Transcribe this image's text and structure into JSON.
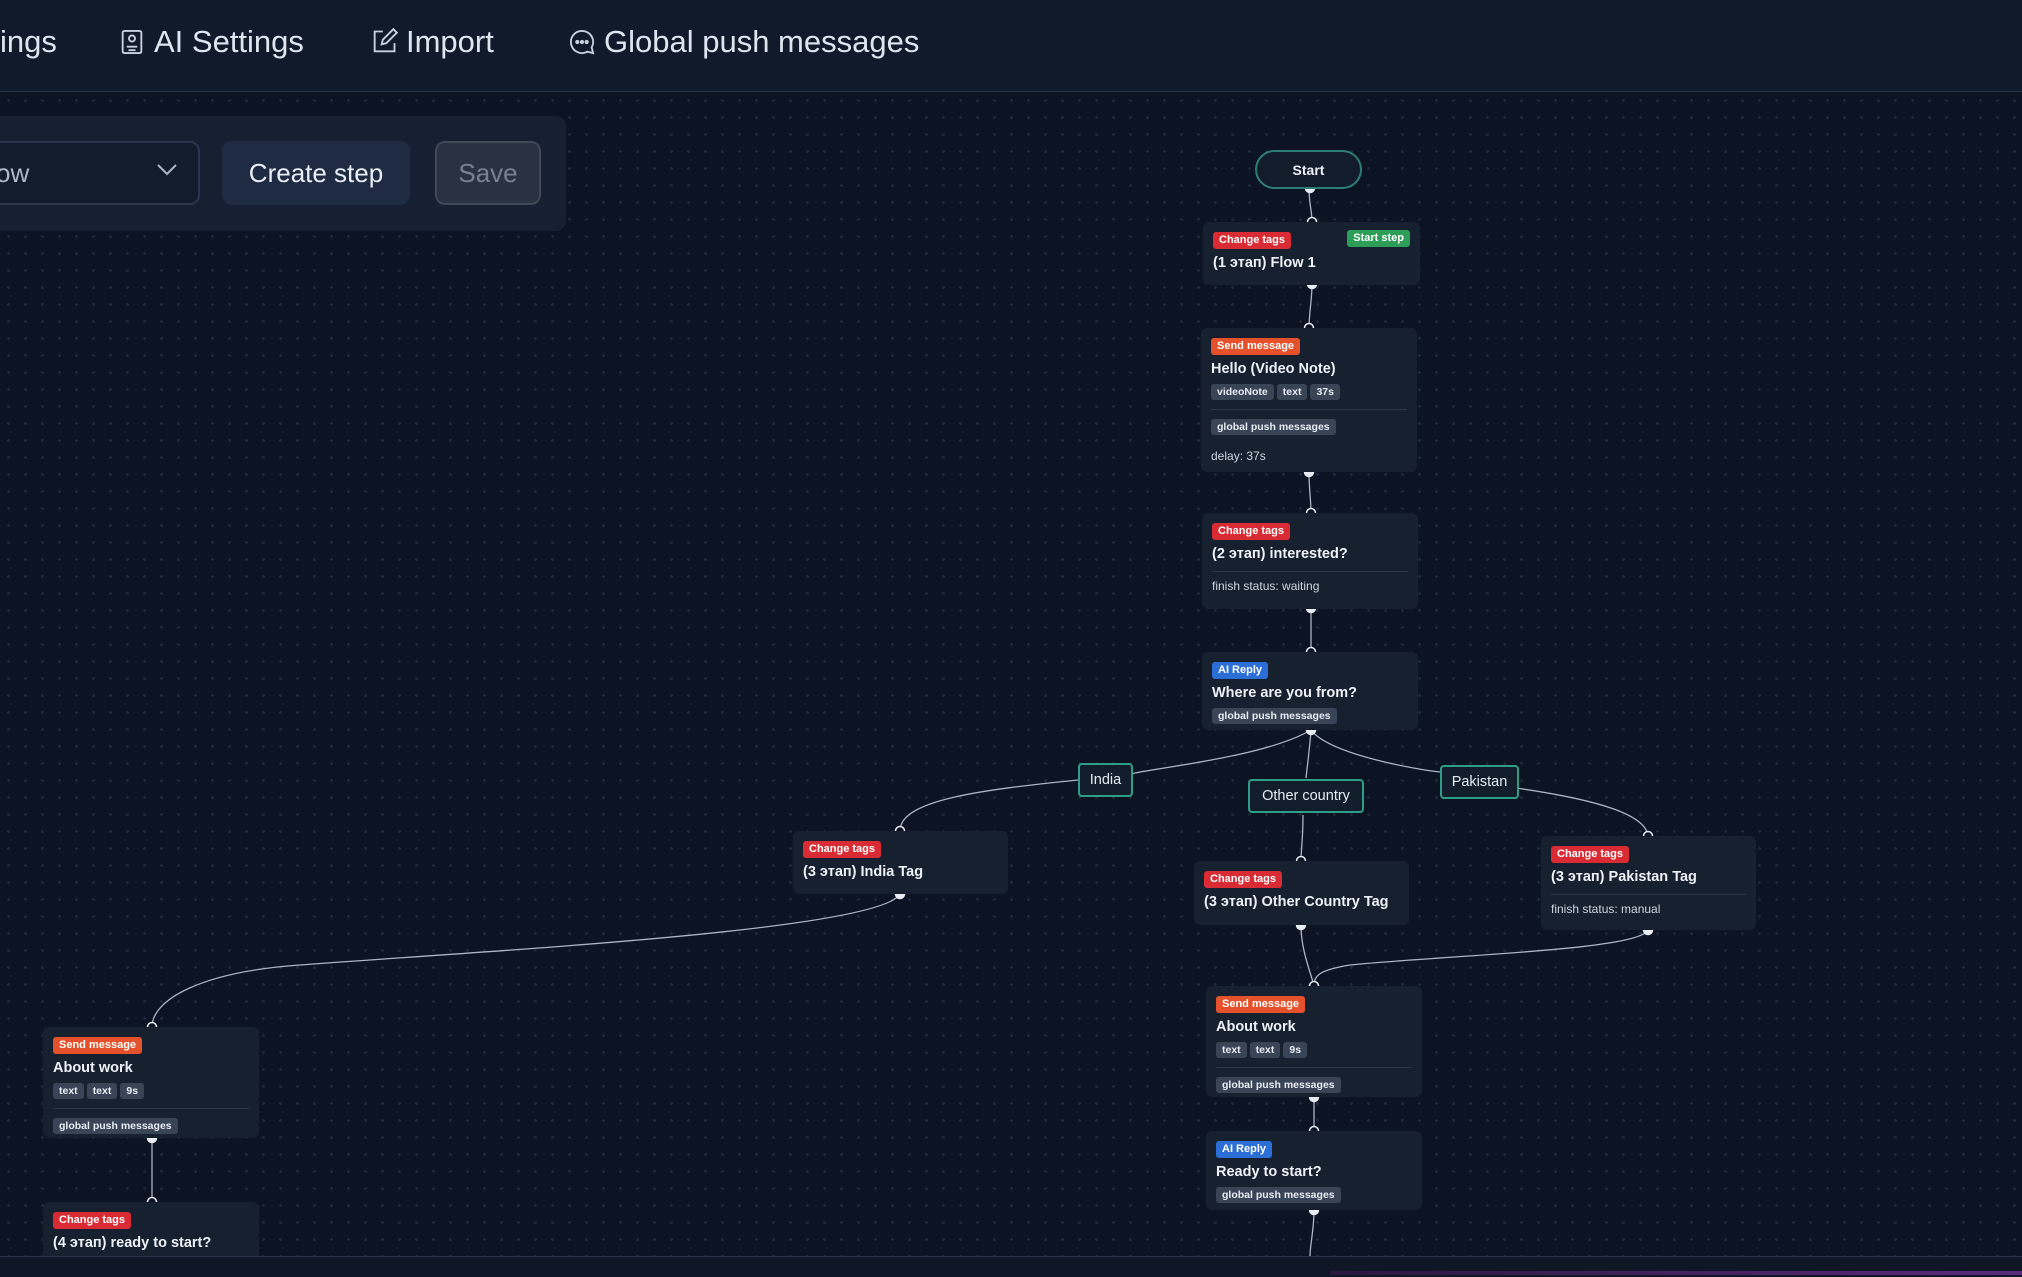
{
  "topnav": {
    "settings_label": "ings",
    "ai_settings_label": "AI Settings",
    "import_label": "Import",
    "global_push_label": "Global push messages"
  },
  "toolbar": {
    "flow_select_value": "ow",
    "create_label": "Create step",
    "save_label": "Save"
  },
  "flow": {
    "start_label": "Start",
    "nodes": [
      {
        "badges": [
          "Change tags",
          "Start step"
        ],
        "title": "(1 этап) Flow 1"
      },
      {
        "badges": [
          "Send message"
        ],
        "title": "Hello (Video Note)",
        "chips": [
          "videoNote",
          "text",
          "37s"
        ],
        "tags": [
          "global push messages"
        ],
        "meta": "delay: 37s"
      },
      {
        "badges": [
          "Change tags"
        ],
        "title": "(2 этап) interested?",
        "meta": "finish status: waiting"
      },
      {
        "badges": [
          "AI Reply"
        ],
        "title": "Where are you from?",
        "tags": [
          "global push messages"
        ]
      },
      {
        "badges": [
          "Change tags"
        ],
        "title": "(3 этап) India Tag"
      },
      {
        "badges": [
          "Change tags"
        ],
        "title": "(3 этап) Other Country Tag"
      },
      {
        "badges": [
          "Change tags"
        ],
        "title": "(3 этап) Pakistan Tag",
        "meta": "finish status: manual"
      },
      {
        "badges": [
          "Send message"
        ],
        "title": "About work",
        "chips": [
          "text",
          "text",
          "9s"
        ],
        "tags": [
          "global push messages"
        ]
      },
      {
        "badges": [
          "AI Reply"
        ],
        "title": "Ready to start?",
        "tags": [
          "global push messages"
        ]
      },
      {
        "badges": [
          "Send message"
        ],
        "title": "About work",
        "chips": [
          "text",
          "text",
          "9s"
        ],
        "tags": [
          "global push messages"
        ]
      },
      {
        "badges": [
          "Change tags"
        ],
        "title": "(4 этап) ready to start?"
      }
    ],
    "branches": [
      "India",
      "Other country",
      "Pakistan"
    ]
  },
  "colors": {
    "background": "#0c1424",
    "node": "#17202f",
    "change_tags": "#d92b34",
    "send_message": "#e5512a",
    "start_step": "#2d9e58",
    "ai_reply": "#2b6fd6",
    "branch_border": "#2f9e86"
  }
}
